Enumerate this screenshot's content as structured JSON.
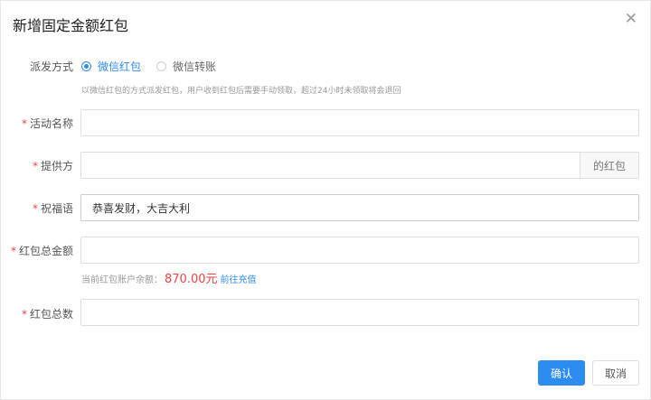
{
  "dialog": {
    "title": "新增固定金额红包",
    "close_icon": "close-icon"
  },
  "form": {
    "method": {
      "label": "派发方式",
      "options": [
        {
          "label": "微信红包",
          "selected": true
        },
        {
          "label": "微信转账",
          "selected": false
        }
      ],
      "hint": "以微信红包的方式派发红包，用户收到红包后需要手动领取，超过24小时未领取将会退回"
    },
    "activity_name": {
      "required": "*",
      "label": "活动名称",
      "value": "",
      "placeholder": ""
    },
    "provider": {
      "required": "*",
      "label": "提供方",
      "value": "",
      "suffix": "的红包"
    },
    "blessing": {
      "required": "*",
      "label": "祝福语",
      "value": "恭喜发财，大吉大利"
    },
    "total_amount": {
      "required": "*",
      "label": "红包总金额",
      "value": "",
      "balance_text": "当前红包账户余额：",
      "balance_amount": "870.00元",
      "recharge_link": "前往充值"
    },
    "total_count": {
      "required": "*",
      "label": "红包总数",
      "value": ""
    }
  },
  "footer": {
    "confirm_label": "确认",
    "cancel_label": "取消"
  },
  "colors": {
    "primary": "#2d8cf0",
    "required": "#ee4343",
    "amount": "#ee4343"
  }
}
